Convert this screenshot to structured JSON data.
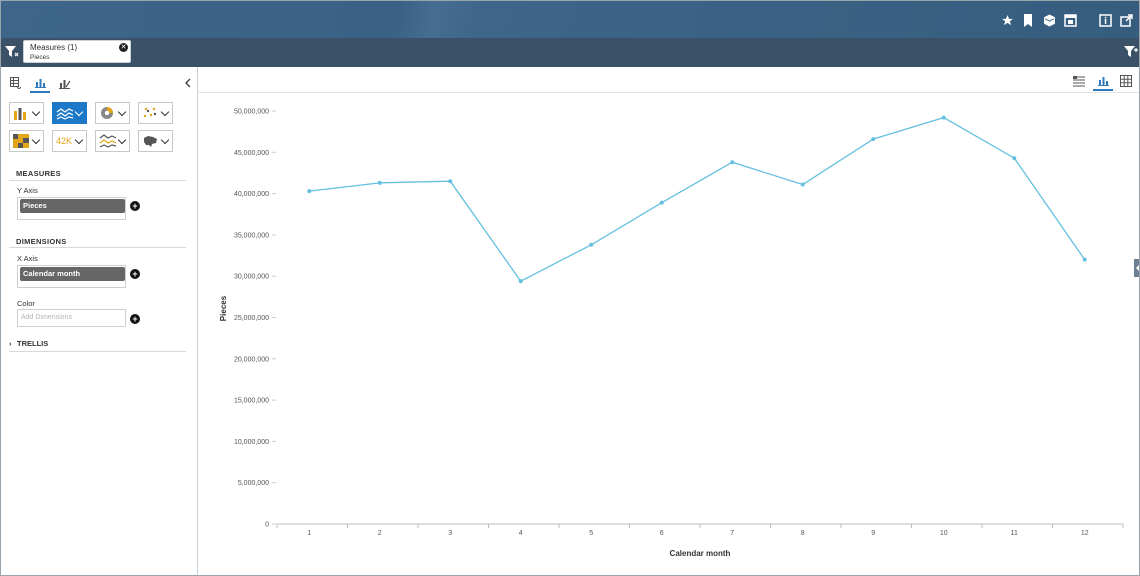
{
  "filter": {
    "chip_title": "Measures (1)",
    "chip_value": "Pieces"
  },
  "panel": {
    "measures_header": "MEASURES",
    "y_axis_label": "Y Axis",
    "y_axis_pill": "Pieces",
    "dimensions_header": "DIMENSIONS",
    "x_axis_label": "X Axis",
    "x_axis_pill": "Calendar month",
    "color_label": "Color",
    "color_placeholder": "Add Dimensions",
    "trellis_header": "TRELLIS",
    "kpi_label": "42K"
  },
  "chart_data": {
    "type": "line",
    "xlabel": "Calendar month",
    "ylabel": "Pieces",
    "categories": [
      "1",
      "2",
      "3",
      "4",
      "5",
      "6",
      "7",
      "8",
      "9",
      "10",
      "11",
      "12"
    ],
    "series": [
      {
        "values": [
          40300000,
          41300000,
          41500000,
          29400000,
          33800000,
          38900000,
          43800000,
          41100000,
          46600000,
          49200000,
          44300000,
          32000000
        ]
      }
    ],
    "ylim": [
      0,
      50000000
    ],
    "yticks": [
      0,
      5000000,
      10000000,
      15000000,
      20000000,
      25000000,
      30000000,
      35000000,
      40000000,
      45000000,
      50000000
    ],
    "ytick_labels": [
      "0",
      "5,000,000",
      "10,000,000",
      "15,000,000",
      "20,000,000",
      "25,000,000",
      "30,000,000",
      "35,000,000",
      "40,000,000",
      "45,000,000",
      "50,000,000"
    ],
    "line_color": "#64bfe0",
    "grid": false
  }
}
